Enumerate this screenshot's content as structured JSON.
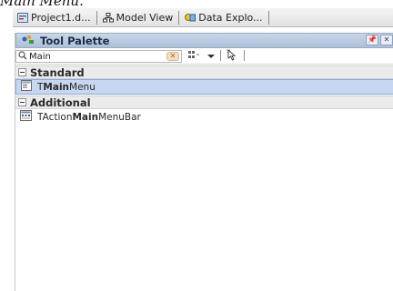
{
  "caption": "Main Menu.",
  "tabs": [
    {
      "label": "Project1.d...",
      "icon": "project-icon"
    },
    {
      "label": "Model View",
      "icon": "model-view-icon"
    },
    {
      "label": "Data Explo...",
      "icon": "data-explorer-icon"
    }
  ],
  "palette": {
    "title": "Tool Palette",
    "title_buttons": [
      "pin",
      "close"
    ],
    "search": {
      "value": "Main",
      "placeholder": ""
    },
    "toolbar_icons": [
      "search-icon",
      "categories-icon",
      "dropdown-icon",
      "pointer-icon"
    ],
    "groups": [
      {
        "name": "Standard",
        "items": [
          {
            "pre": "T",
            "bold": "Main",
            "post": "Menu",
            "selected": true,
            "icon": "mainmenu-icon"
          }
        ]
      },
      {
        "name": "Additional",
        "items": [
          {
            "pre": "TAction",
            "bold": "Main",
            "post": "MenuBar",
            "selected": false,
            "icon": "actionmenubar-icon"
          }
        ]
      }
    ]
  }
}
